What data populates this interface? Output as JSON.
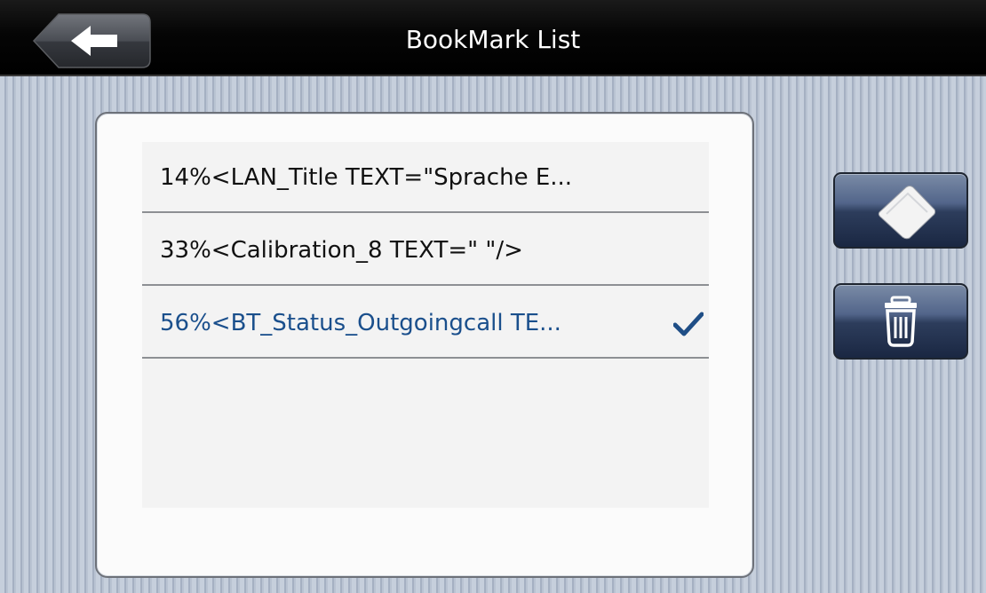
{
  "header": {
    "title": "BookMark List",
    "back_icon": "arrow-left-icon"
  },
  "bookmarks": [
    {
      "label": "14%<LAN_Title TEXT=\"Sprache E...",
      "selected": false
    },
    {
      "label": "33%<Calibration_8 TEXT=\" \"/>",
      "selected": false
    },
    {
      "label": "56%<BT_Status_Outgoingcall TE...",
      "selected": true
    }
  ],
  "side_buttons": {
    "edit_icon": "eraser-icon",
    "delete_icon": "trash-icon"
  },
  "colors": {
    "selected_text": "#1a4f8c",
    "header_bg": "#000000",
    "button_bg": "#2d3d5c"
  }
}
